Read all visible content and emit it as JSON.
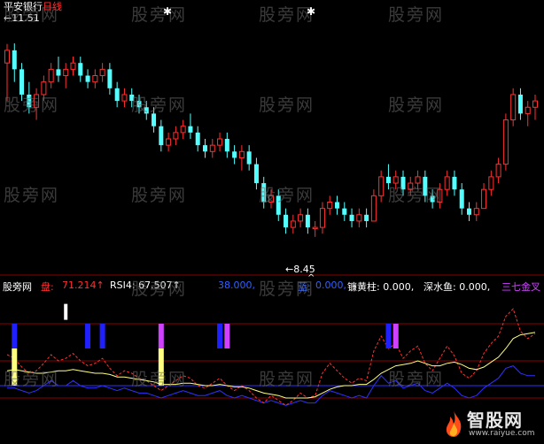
{
  "header": {
    "stock_name": "平安银行",
    "period": "日线",
    "high_label": "←11.51",
    "low_label": "←8.45"
  },
  "watermark": "股旁网",
  "indicator_line": {
    "prefix": "股旁网",
    "item1_label": "盘:",
    "item1_value": "71.214↑",
    "item2": "RSI4: 67.507↑",
    "item3": "蓝:",
    "item3_value": "38.000,",
    "item4": "蓝:",
    "item4_value": "0.000,",
    "item5": "镰黄柱: 0.000,",
    "item6": "深水鱼: 0.000,",
    "item7": "三七金叉"
  },
  "logo": {
    "name": "智股网",
    "url": "www.raiyue.com"
  },
  "colors": {
    "up": "#ff3030",
    "down": "#54ffff",
    "grid": "#8a0000",
    "rsi": "#ff3030",
    "ma": "#ffff80",
    "blue_line": "#3030ff",
    "purple": "#d040ff"
  },
  "chart_data": {
    "type": "candlestick",
    "price_ylim": [
      8.0,
      12.0
    ],
    "candles": [
      [
        11.2,
        11.5,
        10.6,
        11.4
      ],
      [
        11.4,
        11.51,
        10.9,
        11.1
      ],
      [
        11.1,
        11.2,
        10.6,
        10.7
      ],
      [
        10.7,
        10.9,
        10.4,
        10.5
      ],
      [
        10.5,
        10.8,
        10.3,
        10.7
      ],
      [
        10.7,
        11.0,
        10.6,
        10.9
      ],
      [
        10.9,
        11.2,
        10.8,
        11.1
      ],
      [
        11.1,
        11.3,
        10.9,
        11.0
      ],
      [
        11.0,
        11.2,
        10.8,
        11.1
      ],
      [
        11.1,
        11.3,
        11.0,
        11.2
      ],
      [
        11.2,
        11.3,
        10.9,
        11.0
      ],
      [
        11.0,
        11.1,
        10.8,
        10.9
      ],
      [
        10.9,
        11.1,
        10.8,
        11.0
      ],
      [
        11.0,
        11.2,
        10.9,
        11.1
      ],
      [
        11.1,
        11.2,
        10.7,
        10.8
      ],
      [
        10.8,
        10.9,
        10.5,
        10.6
      ],
      [
        10.6,
        10.8,
        10.5,
        10.7
      ],
      [
        10.7,
        10.8,
        10.5,
        10.6
      ],
      [
        10.6,
        10.7,
        10.4,
        10.5
      ],
      [
        10.5,
        10.6,
        10.3,
        10.4
      ],
      [
        10.4,
        10.5,
        10.1,
        10.2
      ],
      [
        10.2,
        10.3,
        9.8,
        9.9
      ],
      [
        9.9,
        10.1,
        9.8,
        10.0
      ],
      [
        10.0,
        10.2,
        9.9,
        10.1
      ],
      [
        10.1,
        10.3,
        10.0,
        10.2
      ],
      [
        10.2,
        10.4,
        10.0,
        10.1
      ],
      [
        10.1,
        10.2,
        9.8,
        9.9
      ],
      [
        9.9,
        10.0,
        9.7,
        9.8
      ],
      [
        9.8,
        10.0,
        9.7,
        9.9
      ],
      [
        9.9,
        10.1,
        9.8,
        10.0
      ],
      [
        10.0,
        10.1,
        9.7,
        9.8
      ],
      [
        9.8,
        9.9,
        9.6,
        9.7
      ],
      [
        9.7,
        9.9,
        9.5,
        9.8
      ],
      [
        9.8,
        9.9,
        9.5,
        9.6
      ],
      [
        9.6,
        9.7,
        9.2,
        9.3
      ],
      [
        9.3,
        9.4,
        8.9,
        9.0
      ],
      [
        9.0,
        9.2,
        8.9,
        9.1
      ],
      [
        9.1,
        9.2,
        8.7,
        8.8
      ],
      [
        8.8,
        8.9,
        8.5,
        8.6
      ],
      [
        8.6,
        8.8,
        8.5,
        8.7
      ],
      [
        8.7,
        8.9,
        8.6,
        8.8
      ],
      [
        8.8,
        8.9,
        8.5,
        8.6
      ],
      [
        8.6,
        8.7,
        8.45,
        8.6
      ],
      [
        8.6,
        9.0,
        8.5,
        8.9
      ],
      [
        8.9,
        9.1,
        8.8,
        9.0
      ],
      [
        9.0,
        9.1,
        8.8,
        8.9
      ],
      [
        8.9,
        9.0,
        8.7,
        8.8
      ],
      [
        8.8,
        8.9,
        8.6,
        8.7
      ],
      [
        8.7,
        8.9,
        8.6,
        8.8
      ],
      [
        8.8,
        8.9,
        8.6,
        8.7
      ],
      [
        8.7,
        9.2,
        8.7,
        9.1
      ],
      [
        9.1,
        9.5,
        9.0,
        9.4
      ],
      [
        9.4,
        9.6,
        9.2,
        9.3
      ],
      [
        9.3,
        9.5,
        9.2,
        9.4
      ],
      [
        9.4,
        9.5,
        9.1,
        9.2
      ],
      [
        9.2,
        9.4,
        9.1,
        9.3
      ],
      [
        9.3,
        9.5,
        9.2,
        9.4
      ],
      [
        9.4,
        9.5,
        9.0,
        9.1
      ],
      [
        9.1,
        9.2,
        8.9,
        9.0
      ],
      [
        9.0,
        9.3,
        8.9,
        9.2
      ],
      [
        9.2,
        9.5,
        9.1,
        9.4
      ],
      [
        9.4,
        9.5,
        9.1,
        9.2
      ],
      [
        9.2,
        9.3,
        8.8,
        8.9
      ],
      [
        8.9,
        9.0,
        8.7,
        8.8
      ],
      [
        8.8,
        9.0,
        8.7,
        8.9
      ],
      [
        8.9,
        9.3,
        8.9,
        9.2
      ],
      [
        9.2,
        9.5,
        9.1,
        9.4
      ],
      [
        9.4,
        9.7,
        9.3,
        9.6
      ],
      [
        9.6,
        10.4,
        9.5,
        10.3
      ],
      [
        10.3,
        10.8,
        10.2,
        10.7
      ],
      [
        10.7,
        10.8,
        10.3,
        10.4
      ],
      [
        10.4,
        10.6,
        10.2,
        10.5
      ],
      [
        10.5,
        10.7,
        10.3,
        10.6
      ]
    ],
    "rsi": [
      55,
      52,
      45,
      40,
      42,
      48,
      55,
      50,
      52,
      56,
      50,
      46,
      48,
      52,
      44,
      38,
      42,
      40,
      36,
      34,
      30,
      26,
      30,
      34,
      38,
      36,
      30,
      28,
      32,
      36,
      30,
      26,
      30,
      26,
      20,
      16,
      22,
      18,
      14,
      18,
      24,
      20,
      22,
      40,
      48,
      42,
      36,
      32,
      36,
      34,
      58,
      70,
      60,
      64,
      52,
      58,
      62,
      48,
      42,
      52,
      62,
      54,
      40,
      36,
      42,
      56,
      64,
      70,
      86,
      92,
      74,
      68,
      72
    ],
    "ma": [
      42,
      43,
      42,
      41,
      40,
      40,
      41,
      42,
      42,
      43,
      42,
      41,
      40,
      40,
      39,
      37,
      37,
      36,
      35,
      34,
      33,
      31,
      31,
      31,
      32,
      32,
      31,
      30,
      30,
      31,
      30,
      29,
      29,
      28,
      26,
      24,
      23,
      22,
      20,
      20,
      20,
      20,
      21,
      24,
      27,
      29,
      30,
      30,
      31,
      31,
      35,
      40,
      43,
      46,
      47,
      48,
      50,
      48,
      46,
      46,
      48,
      49,
      47,
      44,
      43,
      45,
      49,
      53,
      60,
      68,
      71,
      72,
      73
    ],
    "blue": [
      28,
      28,
      26,
      24,
      26,
      30,
      34,
      30,
      30,
      34,
      30,
      28,
      28,
      30,
      28,
      26,
      28,
      26,
      24,
      24,
      22,
      20,
      22,
      24,
      26,
      24,
      22,
      22,
      24,
      26,
      22,
      20,
      22,
      20,
      18,
      16,
      18,
      16,
      14,
      16,
      18,
      16,
      16,
      22,
      26,
      24,
      22,
      20,
      22,
      20,
      30,
      38,
      32,
      34,
      28,
      30,
      32,
      26,
      24,
      28,
      32,
      28,
      22,
      20,
      22,
      28,
      32,
      36,
      44,
      46,
      40,
      38,
      38
    ],
    "signals": [
      {
        "index": 1,
        "type": "blue-yellow"
      },
      {
        "index": 8,
        "type": "white"
      },
      {
        "index": 11,
        "type": "blue"
      },
      {
        "index": 13,
        "type": "blue"
      },
      {
        "index": 21,
        "type": "purple-yellow"
      },
      {
        "index": 29,
        "type": "blue"
      },
      {
        "index": 30,
        "type": "purple"
      },
      {
        "index": 52,
        "type": "blue"
      },
      {
        "index": 53,
        "type": "purple"
      }
    ]
  }
}
